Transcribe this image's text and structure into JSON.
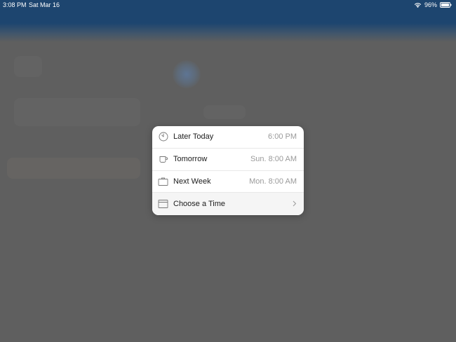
{
  "status_bar": {
    "time": "3:08 PM",
    "date": "Sat Mar 16",
    "battery": "96%"
  },
  "snooze_menu": {
    "options": [
      {
        "label": "Later Today",
        "time": "6:00 PM",
        "icon": "clock-icon"
      },
      {
        "label": "Tomorrow",
        "time": "Sun. 8:00 AM",
        "icon": "coffee-cup-icon"
      },
      {
        "label": "Next Week",
        "time": "Mon. 8:00 AM",
        "icon": "briefcase-icon"
      },
      {
        "label": "Choose a Time",
        "icon": "calendar-icon",
        "trailing": "chevron-right-icon"
      }
    ]
  },
  "colors": {
    "header": "#1d456f",
    "dimmed_background": "#5f5f5f",
    "popover": "#ffffff",
    "secondary_text": "#9a9a9a"
  }
}
